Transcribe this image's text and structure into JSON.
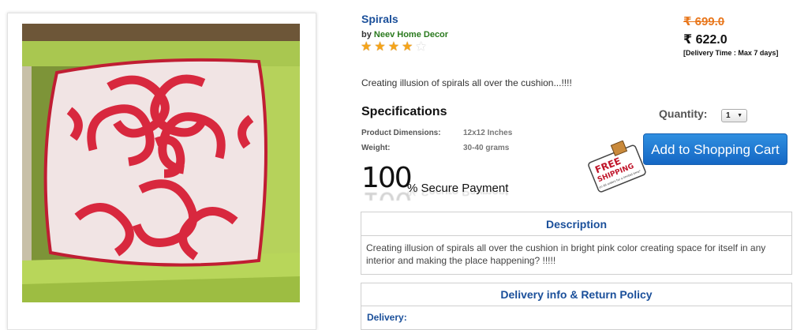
{
  "product": {
    "title": "Spirals",
    "by_label": "by",
    "seller": "Neev Home Decor",
    "rating": 4,
    "rating_max": 5,
    "tagline": "Creating illusion of spirals all over the cushion...!!!!"
  },
  "pricing": {
    "old_price": "₹ 699.0",
    "new_price": "₹ 622.0",
    "delivery_time": "[Delivery Time : Max 7 days]"
  },
  "specs": {
    "heading": "Specifications",
    "rows": [
      {
        "label": "Product Dimensions:",
        "value": "12x12 Inches"
      },
      {
        "label": "Weight:",
        "value": "30-40 grams"
      }
    ]
  },
  "purchase": {
    "quantity_label": "Quantity:",
    "quantity_value": "1",
    "cart_button": "Add to Shopping Cart",
    "free_shipping_line1": "FREE",
    "free_shipping_line2": "SHIPPING",
    "free_shipping_note": "on All orders for a limited time*"
  },
  "secure": {
    "big": "100",
    "small": "% Secure Payment"
  },
  "description": {
    "title": "Description",
    "text": "Creating illusion of spirals all over the cushion in bright pink color creating space for itself in any interior and making the place happening? !!!!!"
  },
  "delivery_policy": {
    "title": "Delivery info & Return Policy",
    "delivery_label": "Delivery:"
  },
  "colors": {
    "link_blue": "#1a4f9a",
    "seller_green": "#2a7a1e",
    "old_price_orange": "#e8761b",
    "star_gold": "#f5a41a",
    "cart_blue": "#1f7ad6",
    "cushion_pink": "#d8283e"
  }
}
